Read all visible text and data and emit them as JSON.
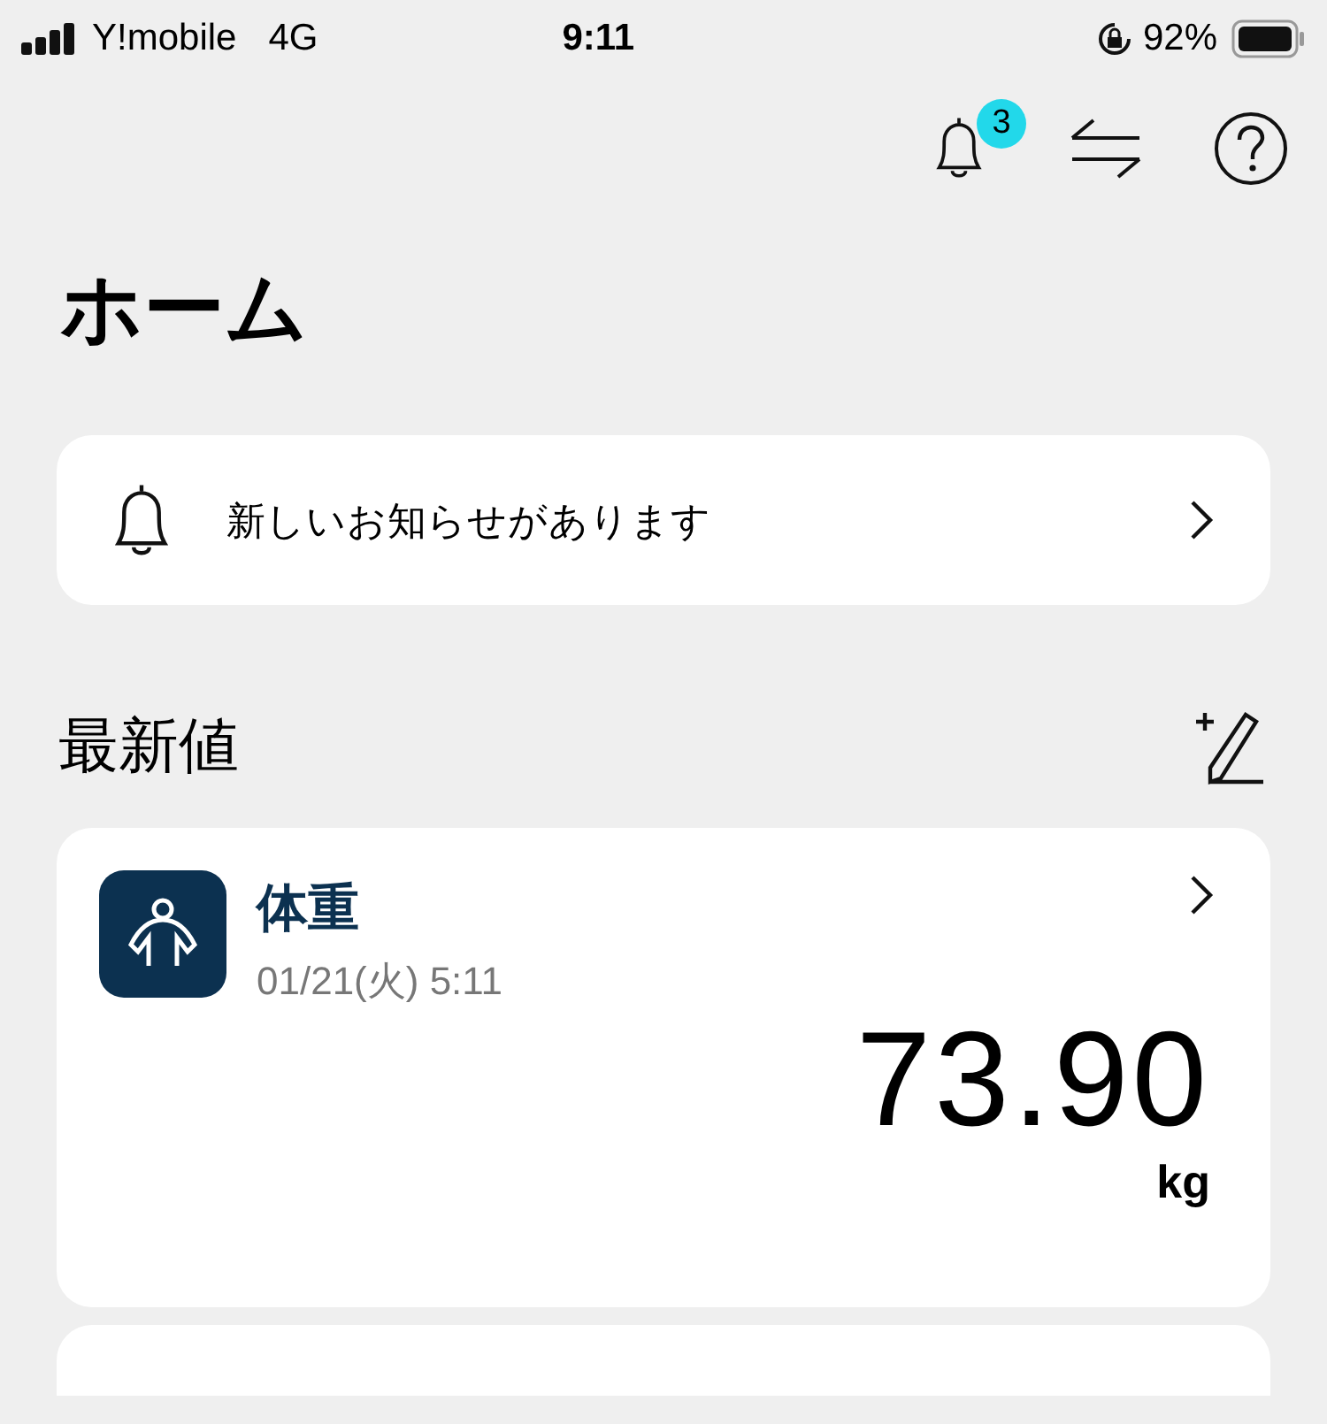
{
  "status_bar": {
    "carrier": "Y!mobile",
    "network": "4G",
    "time": "9:11",
    "battery": "92%"
  },
  "toolbar": {
    "notification_count": "3"
  },
  "title": "ホーム",
  "notice": {
    "text": "新しいお知らせがあります"
  },
  "section": {
    "title": "最新値"
  },
  "cards": [
    {
      "title": "体重",
      "datetime": "01/21(火) 5:11",
      "value": "73.90",
      "unit": "kg"
    }
  ]
}
